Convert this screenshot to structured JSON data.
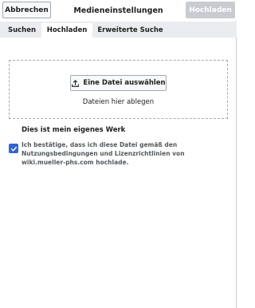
{
  "header": {
    "cancel_label": "Abbrechen",
    "title": "Medieneinstellungen",
    "upload_label": "Hochladen"
  },
  "tabs": [
    {
      "label": "Suchen",
      "active": false
    },
    {
      "label": "Hochladen",
      "active": true
    },
    {
      "label": "Erweiterte Suche",
      "active": false
    }
  ],
  "dropzone": {
    "select_label": "Eine Datei auswählen",
    "select_icon": "upload-icon",
    "hint": "Dateien hier ablegen"
  },
  "own_work": {
    "heading": "Dies ist mein eigenes Werk",
    "checked": true,
    "confirm_text": "Ich bestätige, dass ich diese Datei gemäß den Nutzungsbedingungen und Lizenzrichtlinien von wiki.mueller-phs.com hochlade."
  },
  "colors": {
    "accent": "#3366cc",
    "disabled_button": "#c8ccd1",
    "tabbar_bg": "#eaecf0"
  }
}
